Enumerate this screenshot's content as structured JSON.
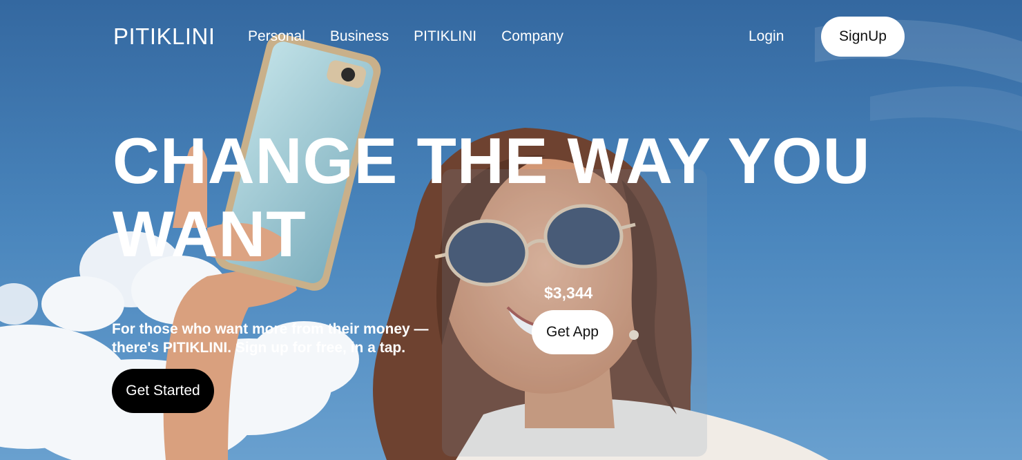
{
  "brand": {
    "logo_text": "PITIKLINI"
  },
  "nav": {
    "links": [
      {
        "label": "Personal"
      },
      {
        "label": "Business"
      },
      {
        "label": "PITIKLINI"
      },
      {
        "label": "Company"
      }
    ],
    "login_label": "Login",
    "signup_label": "SignUp"
  },
  "hero": {
    "headline_line1": "CHANGE THE WAY YOU",
    "headline_line2": "WANT",
    "subtext_line1": "For those who want more from their money —",
    "subtext_line2": "there's PITIKLINI. Sign up for free, in a tap.",
    "cta_label": "Get Started"
  },
  "promo_card": {
    "balance": "$3,344",
    "button_label": "Get App"
  },
  "colors": {
    "sky": "#4a84bb",
    "cta_dark": "#000000",
    "button_light": "#ffffff"
  }
}
